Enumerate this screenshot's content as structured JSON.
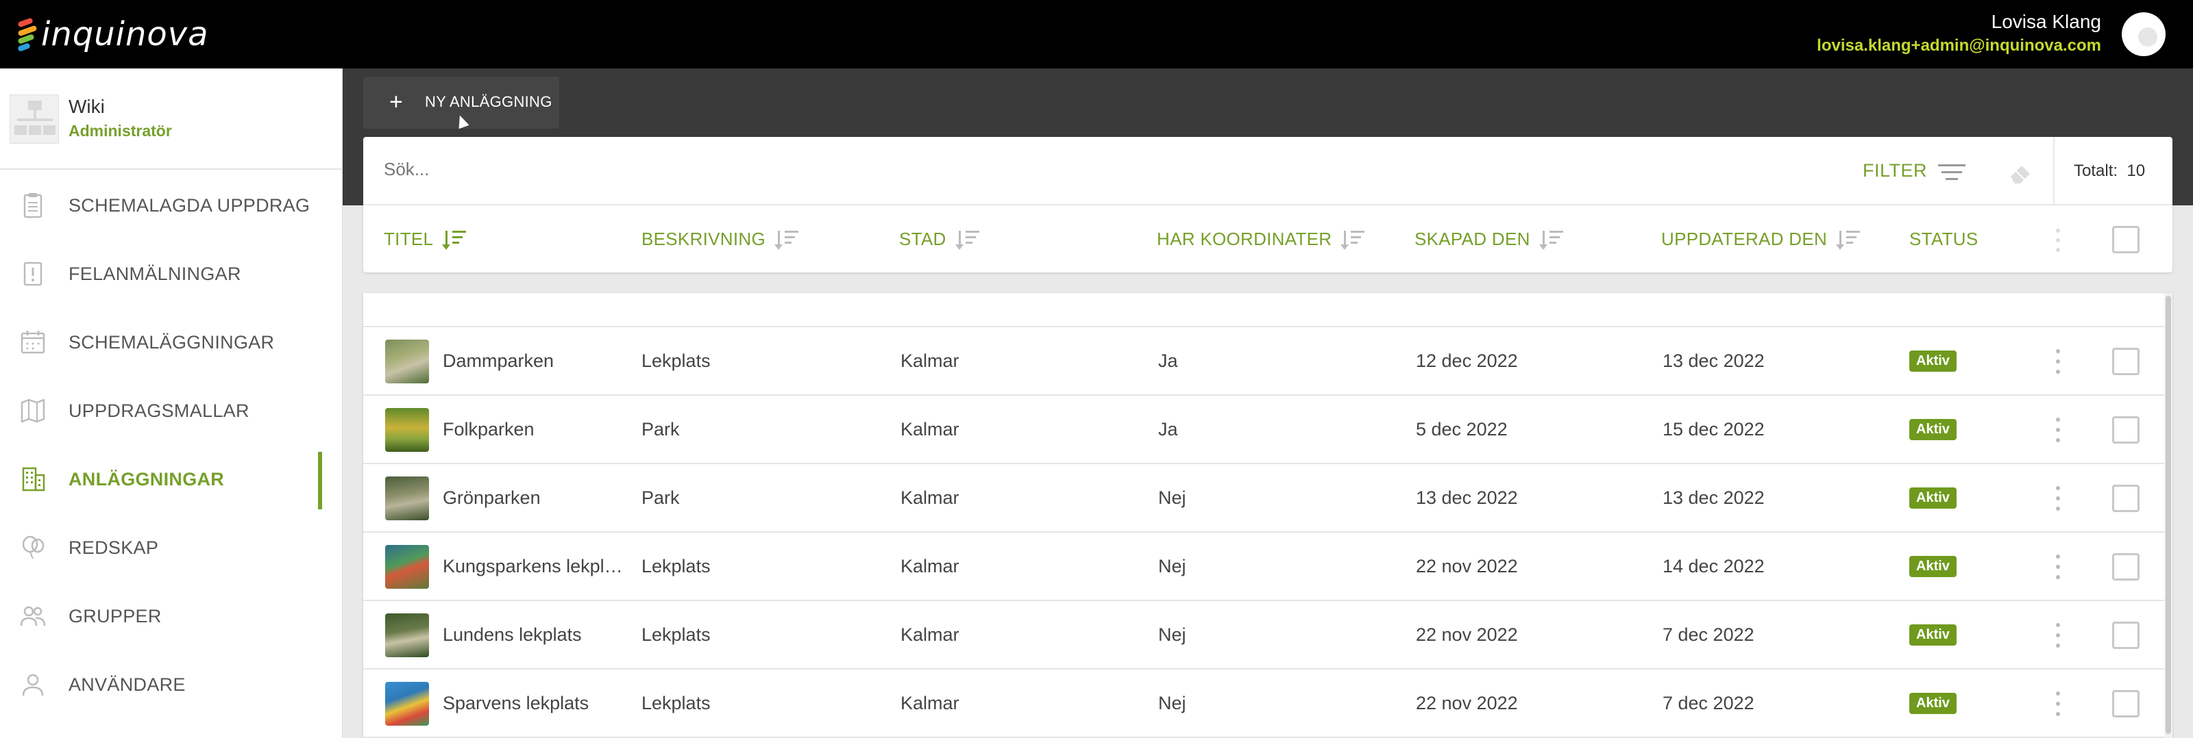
{
  "app": {
    "brand": "inquinova"
  },
  "user": {
    "name": "Lovisa Klang",
    "email": "lovisa.klang+admin@inquinova.com"
  },
  "workspace": {
    "name": "Wiki",
    "role": "Administratör"
  },
  "sidebar": {
    "items": [
      {
        "label": "SCHEMALAGDA UPPDRAG",
        "icon": "clipboard-icon"
      },
      {
        "label": "FELANMÄLNINGAR",
        "icon": "alert-note-icon"
      },
      {
        "label": "SCHEMALÄGGNINGAR",
        "icon": "calendar-icon"
      },
      {
        "label": "UPPDRAGSMALLAR",
        "icon": "map-icon"
      },
      {
        "label": "ANLÄGGNINGAR",
        "icon": "building-icon",
        "active": true
      },
      {
        "label": "REDSKAP",
        "icon": "balloon-icon"
      },
      {
        "label": "GRUPPER",
        "icon": "group-icon"
      },
      {
        "label": "ANVÄNDARE",
        "icon": "user-icon"
      }
    ]
  },
  "toolbar": {
    "new_label": "NY ANLÄGGNING"
  },
  "search": {
    "placeholder": "Sök..."
  },
  "filter": {
    "label": "FILTER",
    "total_label": "Totalt:",
    "total_value": "10"
  },
  "table": {
    "columns": [
      "TITEL",
      "BESKRIVNING",
      "STAD",
      "HAR KOORDINATER",
      "SKAPAD DEN",
      "UPPDATERAD DEN",
      "STATUS"
    ],
    "rows": [
      {
        "title": "Dammparken",
        "description": "Lekplats",
        "city": "Kalmar",
        "coords": "Ja",
        "created": "12 dec 2022",
        "updated": "13 dec 2022",
        "status": "Aktiv"
      },
      {
        "title": "Folkparken",
        "description": "Park",
        "city": "Kalmar",
        "coords": "Ja",
        "created": "5 dec 2022",
        "updated": "15 dec 2022",
        "status": "Aktiv"
      },
      {
        "title": "Grönparken",
        "description": "Park",
        "city": "Kalmar",
        "coords": "Nej",
        "created": "13 dec 2022",
        "updated": "13 dec 2022",
        "status": "Aktiv"
      },
      {
        "title": "Kungsparkens lekpl…",
        "description": "Lekplats",
        "city": "Kalmar",
        "coords": "Nej",
        "created": "22 nov 2022",
        "updated": "14 dec 2022",
        "status": "Aktiv"
      },
      {
        "title": "Lundens lekplats",
        "description": "Lekplats",
        "city": "Kalmar",
        "coords": "Nej",
        "created": "22 nov 2022",
        "updated": "7 dec 2022",
        "status": "Aktiv"
      },
      {
        "title": "Sparvens lekplats",
        "description": "Lekplats",
        "city": "Kalmar",
        "coords": "Nej",
        "created": "22 nov 2022",
        "updated": "7 dec 2022",
        "status": "Aktiv"
      }
    ]
  },
  "colors": {
    "accent": "#76a02a",
    "badge": "#6f9a1d",
    "email": "#c4d92e",
    "topbar": "#000000",
    "band": "#3a3a3a"
  }
}
